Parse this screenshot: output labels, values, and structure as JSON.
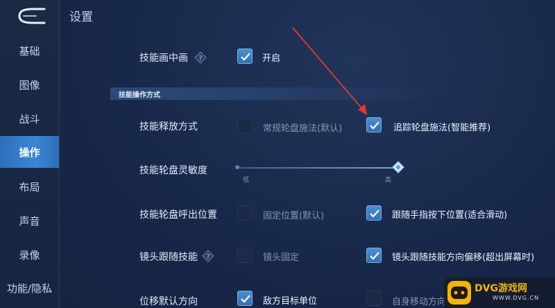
{
  "header": {
    "title": "设置"
  },
  "sidebar": {
    "items": [
      {
        "label": "基础"
      },
      {
        "label": "图像"
      },
      {
        "label": "战斗"
      },
      {
        "label": "操作"
      },
      {
        "label": "布局"
      },
      {
        "label": "声音"
      },
      {
        "label": "录像"
      },
      {
        "label": "功能/隐私"
      }
    ],
    "active_index": 3
  },
  "settings": {
    "skill_picture_in_picture": {
      "label": "技能画中画",
      "checked": true,
      "option": "开启"
    },
    "section_title": "技能操作方式",
    "skill_release": {
      "label": "技能释放方式",
      "option_a": "常规轮盘施法(默认)",
      "option_a_checked": false,
      "option_b": "追踪轮盘施法(智能推荐)",
      "option_b_checked": true
    },
    "wheel_sensitivity": {
      "label": "技能轮盘灵敏度",
      "low": "低",
      "high": "高",
      "level": 1.0
    },
    "wheel_position": {
      "label": "技能轮盘呼出位置",
      "option_a": "固定位置(默认)",
      "option_a_checked": false,
      "option_b": "跟随手指按下位置(适合滑动)",
      "option_b_checked": true
    },
    "camera_follow": {
      "label": "镜头跟随技能",
      "option_a": "镜头固定",
      "option_a_checked": false,
      "option_b": "镜头跟随技能方向偏移(超出屏幕时)",
      "option_b_checked": true
    },
    "dash_direction": {
      "label": "位移默认方向",
      "option_a": "敌方目标单位",
      "option_a_checked": true,
      "option_b": "自身移动方向",
      "option_b_checked": false
    }
  },
  "watermark": {
    "name": "DVG游戏网",
    "url": "WWW.DVG.CN"
  },
  "colors": {
    "accent": "#3a86d6",
    "annotation_arrow": "#e23a2e",
    "watermark": "#f5b400"
  }
}
